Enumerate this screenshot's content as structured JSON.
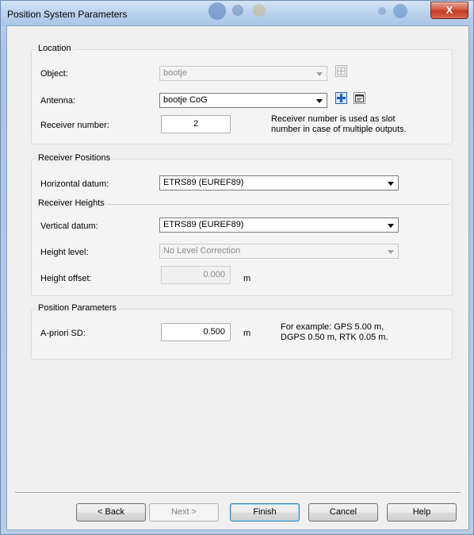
{
  "window": {
    "title": "Position System Parameters",
    "close_label": "X"
  },
  "location": {
    "heading": "Location",
    "object_label": "Object:",
    "object_value": "bootje",
    "antenna_label": "Antenna:",
    "antenna_value": "bootje CoG",
    "receiver_number_label": "Receiver number:",
    "receiver_number_value": "2",
    "receiver_note_line1": "Receiver number is used as slot",
    "receiver_note_line2": "number in case of multiple outputs."
  },
  "receiver_positions": {
    "heading": "Receiver Positions",
    "horizontal_datum_label": "Horizontal datum:",
    "horizontal_datum_value": "ETRS89 (EUREF89)"
  },
  "receiver_heights": {
    "heading": "Receiver Heights",
    "vertical_datum_label": "Vertical datum:",
    "vertical_datum_value": "ETRS89 (EUREF89)",
    "height_level_label": "Height level:",
    "height_level_value": "No Level Correction",
    "height_offset_label": "Height offset:",
    "height_offset_value": "0.000",
    "height_offset_unit": "m"
  },
  "position_parameters": {
    "heading": "Position Parameters",
    "apriori_label": "A-priori SD:",
    "apriori_value": "0.500",
    "apriori_unit": "m",
    "example_line1": "For example: GPS 5.00 m,",
    "example_line2": "DGPS 0.50 m, RTK 0.05 m."
  },
  "footer": {
    "back_label": "< Back",
    "next_label": "Next >",
    "finish_label": "Finish",
    "cancel_label": "Cancel",
    "help_label": "Help"
  },
  "icons": {
    "object_icon": "grid-select-icon",
    "antenna_add_icon": "add-plus-icon",
    "antenna_properties_icon": "properties-icon"
  },
  "colors": {
    "window_frame": "#b6cde9",
    "client_bg": "#f0f0f0",
    "close_button": "#c8442c",
    "default_button_border": "#3c7fb1"
  }
}
